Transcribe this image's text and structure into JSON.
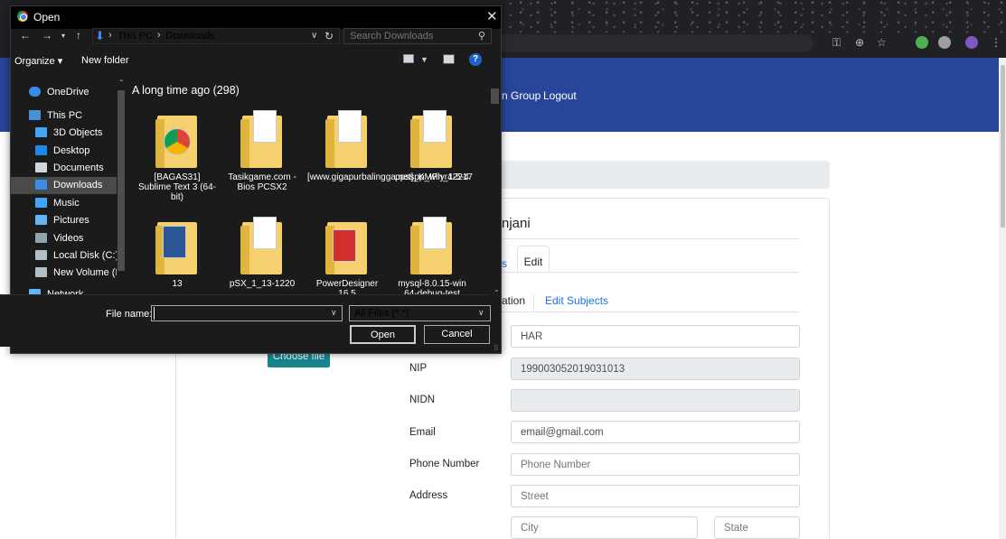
{
  "dialog": {
    "title": "Open",
    "close_glyph": "✕",
    "path": {
      "root": "This PC",
      "folder": "Downloads",
      "sep": "›"
    },
    "search_placeholder": "Search Downloads",
    "organize_label": "Organize ▾",
    "new_folder_label": "New folder",
    "help_glyph": "?",
    "nav_items": [
      {
        "label": "OneDrive",
        "icon": "cloud-icon",
        "color": "#3b8be8"
      },
      {
        "label": "This PC",
        "icon": "computer-icon",
        "color": "#4a90d9"
      },
      {
        "label": "3D Objects",
        "icon": "cube-icon",
        "color": "#42a5f5"
      },
      {
        "label": "Desktop",
        "icon": "desktop-icon",
        "color": "#1e88e5"
      },
      {
        "label": "Documents",
        "icon": "document-icon",
        "color": "#cfd8dc"
      },
      {
        "label": "Downloads",
        "icon": "download-icon",
        "color": "#3b8be8"
      },
      {
        "label": "Music",
        "icon": "music-icon",
        "color": "#42a5f5"
      },
      {
        "label": "Pictures",
        "icon": "picture-icon",
        "color": "#64b5f6"
      },
      {
        "label": "Videos",
        "icon": "video-icon",
        "color": "#90a4ae"
      },
      {
        "label": "Local Disk (C:)",
        "icon": "disk-icon",
        "color": "#b0bec5"
      },
      {
        "label": "New Volume (D:",
        "icon": "disk-icon",
        "color": "#b0bec5"
      },
      {
        "label": "Network",
        "icon": "network-icon",
        "color": "#64b5f6"
      }
    ],
    "group_header": "A long time ago (298)",
    "files": [
      {
        "name": "[BAGAS31] Sublime Text 3 (64-bit)",
        "icon": "folder-chrome-icon"
      },
      {
        "name": "Tasikgame.com - Bios PCSX2",
        "icon": "folder-icon"
      },
      {
        "name": "[www.gigapurbalingga.net]_KMPlyr42217",
        "icon": "folder-icon"
      },
      {
        "name": "ppsspp_win_1-5-4",
        "icon": "folder-icon"
      },
      {
        "name": "13",
        "icon": "folder-word-icon"
      },
      {
        "name": "pSX_1_13-1220",
        "icon": "folder-icon"
      },
      {
        "name": "PowerDesigner 16.5",
        "icon": "folder-pdf-icon"
      },
      {
        "name": "mysql-8.0.15-win 64-debug-test",
        "icon": "folder-icon"
      }
    ],
    "file_name_label": "File name:",
    "file_name_value": "",
    "filter_value": "All Files (*.*)",
    "open_label": "Open",
    "cancel_label": "Cancel"
  },
  "page": {
    "nav_group": "n Group",
    "nav_logout": "Logout",
    "person_name": "njani",
    "tabs": {
      "partial": "s",
      "edit": "Edit"
    },
    "subtabs": {
      "partial": "ation",
      "edit_subjects": "Edit Subjects"
    },
    "choose_file_label": "Choose file",
    "fields": {
      "name_value": "HAR",
      "nip_label": "NIP",
      "nip_value": "199003052019031013",
      "nidn_label": "NIDN",
      "email_label": "Email",
      "email_value": "email@gmail.com",
      "phone_label": "Phone Number",
      "phone_placeholder": "Phone Number",
      "address_label": "Address",
      "street_placeholder": "Street",
      "city_placeholder": "City",
      "state_placeholder": "State"
    }
  },
  "colors": {
    "header_blue": "#27459a",
    "accent_teal": "#17858e",
    "link_blue": "#1a73e8"
  }
}
